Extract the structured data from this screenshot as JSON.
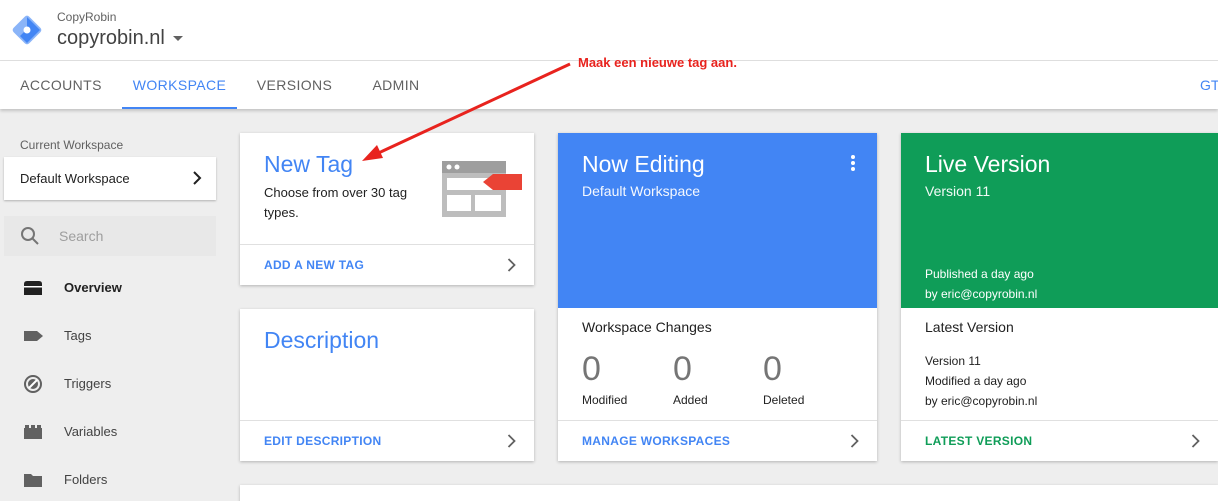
{
  "header": {
    "account_name": "CopyRobin",
    "container_name": "copyrobin.nl"
  },
  "nav": {
    "tabs": [
      {
        "label": "ACCOUNTS",
        "active": false
      },
      {
        "label": "WORKSPACE",
        "active": true
      },
      {
        "label": "VERSIONS",
        "active": false
      },
      {
        "label": "ADMIN",
        "active": false
      }
    ],
    "right_text": "GTM"
  },
  "sidebar": {
    "workspace_label": "Current Workspace",
    "workspace_value": "Default Workspace",
    "search_placeholder": "Search",
    "items": [
      {
        "label": "Overview",
        "icon": "overview-icon",
        "active": true
      },
      {
        "label": "Tags",
        "icon": "tag-icon",
        "active": false
      },
      {
        "label": "Triggers",
        "icon": "trigger-icon",
        "active": false
      },
      {
        "label": "Variables",
        "icon": "variables-icon",
        "active": false
      },
      {
        "label": "Folders",
        "icon": "folder-icon",
        "active": false
      }
    ]
  },
  "new_tag_card": {
    "title": "New Tag",
    "description": "Choose from over 30 tag types.",
    "link": "ADD A NEW TAG"
  },
  "description_card": {
    "title": "Description",
    "link": "EDIT DESCRIPTION"
  },
  "now_editing_card": {
    "title": "Now Editing",
    "subtitle": "Default Workspace",
    "section_title": "Workspace Changes",
    "stats": [
      {
        "value": "0",
        "label": "Modified"
      },
      {
        "value": "0",
        "label": "Added"
      },
      {
        "value": "0",
        "label": "Deleted"
      }
    ],
    "link": "MANAGE WORKSPACES",
    "color": "#4285f4"
  },
  "live_version_card": {
    "title": "Live Version",
    "subtitle": "Version 11",
    "published_line1": "Published a day ago",
    "published_line2": "by eric@copyrobin.nl",
    "section_title": "Latest Version",
    "info_line1": "Version 11",
    "info_line2": "Modified a day ago",
    "info_line3": "by eric@copyrobin.nl",
    "link": "LATEST VERSION",
    "color": "#0f9d58"
  },
  "annotation": {
    "text": "Maak een nieuwe tag aan.",
    "color": "#e8231e"
  }
}
